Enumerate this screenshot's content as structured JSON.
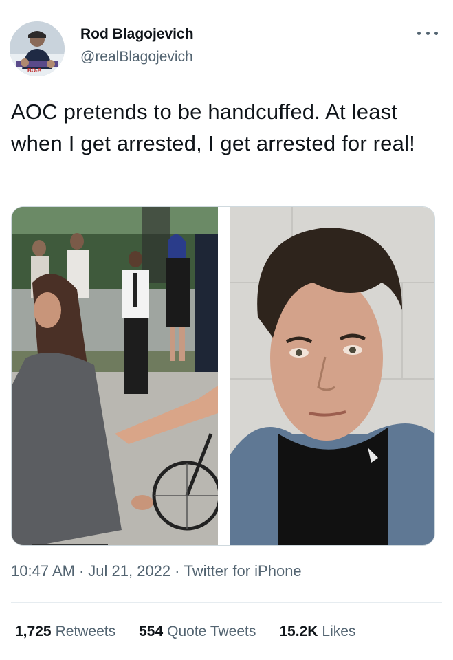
{
  "author": {
    "display_name": "Rod Blagojevich",
    "handle": "@realBlagojevich",
    "avatar_icon": "avatar-photo"
  },
  "tweet": {
    "text": "AOC pretends to be handcuffed. At least when I get arrested, I get arrested for real!",
    "time": "10:47 AM",
    "date": "Jul 21, 2022",
    "source": "Twitter for iPhone",
    "separator": "·"
  },
  "media": {
    "images": [
      {
        "icon": "protest-arrest-photo"
      },
      {
        "icon": "mugshot-photo"
      }
    ]
  },
  "stats": {
    "retweets_count": "1,725",
    "retweets_label": "Retweets",
    "quotes_count": "554",
    "quotes_label": "Quote Tweets",
    "likes_count": "15.2K",
    "likes_label": "Likes"
  },
  "colors": {
    "text_primary": "#0f1419",
    "text_secondary": "#536471",
    "divider": "#e6ecf0"
  }
}
